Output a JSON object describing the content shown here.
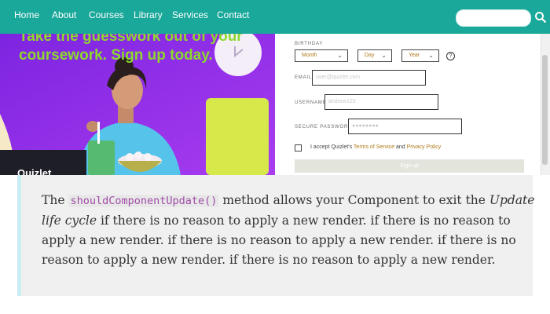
{
  "nav": {
    "links": [
      "Home",
      "About",
      "Courses",
      "Library",
      "Services",
      "Contact"
    ],
    "search_placeholder": "",
    "search_icon": "search-icon",
    "bg_color": "#1aa89a"
  },
  "hero": {
    "tagline": "Take the guesswork out of your coursework. Sign up today.",
    "logo": "Quizlet",
    "bg_color": "#8f2ee8",
    "tagline_color": "#8cd82e"
  },
  "form": {
    "birthday_label": "BIRTHDAY",
    "month": "Month",
    "day": "Day",
    "year": "Year",
    "help_icon": "?",
    "email_label": "EMAIL",
    "email_placeholder": "user@quizlet.com",
    "username_label": "USERNAME",
    "username_placeholder": "andrew123",
    "password_label": "SECURE PASSWORD",
    "password_placeholder": "●●●●●●●●",
    "terms_prefix": "I accept Quizlet's",
    "terms_link": "Terms of Service",
    "terms_and": "and",
    "privacy_link": "Privacy Policy",
    "signup_label": "Sign up",
    "accent_color": "#b07a1a"
  },
  "quote": {
    "lead": "The",
    "code": "shouldComponentUpdate()",
    "mid": "method allows your Component to exit the",
    "em": "Update life cycle",
    "rest": "if there is no reason to apply a new render. if there is no reason to apply a new render. if there is no reason to apply a new render. if there is no reason to apply a new render. if there is no reason to apply a new render.",
    "code_color": "#a04ba6"
  }
}
